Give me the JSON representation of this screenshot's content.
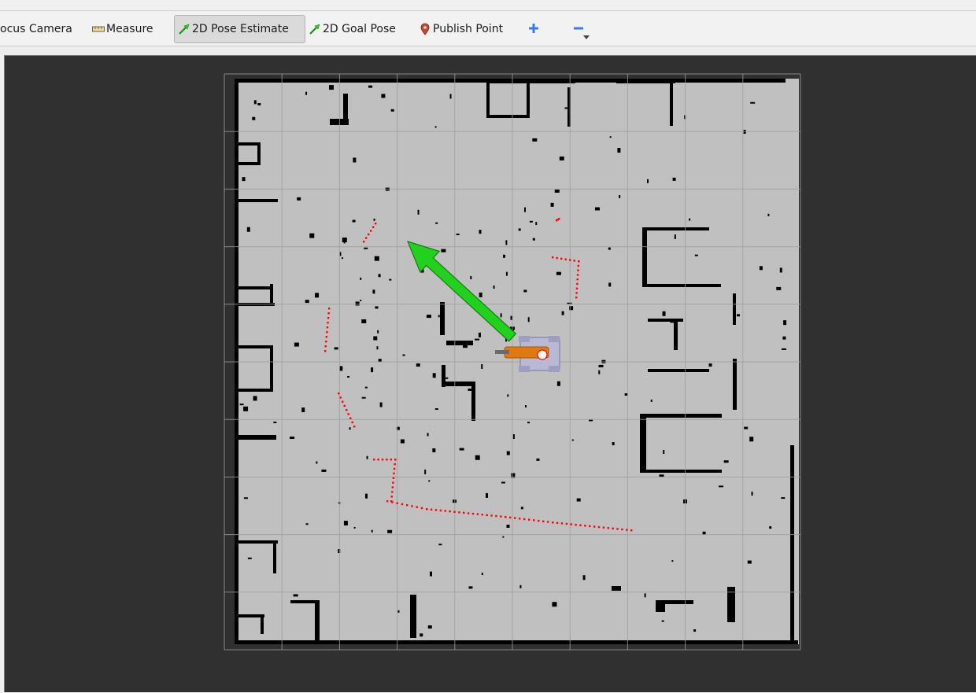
{
  "toolbar": {
    "tools": [
      {
        "id": "focus-camera",
        "label": "ocus Camera",
        "icon": "none"
      },
      {
        "id": "measure",
        "label": "Measure",
        "icon": "ruler-icon"
      },
      {
        "id": "pose-estimate",
        "label": "2D Pose Estimate",
        "icon": "green-arrow-icon",
        "active": true
      },
      {
        "id": "goal-pose",
        "label": "2D Goal Pose",
        "icon": "green-arrow-icon"
      },
      {
        "id": "publish-point",
        "label": "Publish Point",
        "icon": "map-pin-icon"
      }
    ],
    "add_icon": "plus-icon",
    "remove_icon": "minus-icon",
    "dropdown_icon": "caret-down-icon"
  },
  "colors": {
    "viewport_bg": "#303030",
    "map_free": "#c0c0c0",
    "map_occupied": "#000000",
    "grid_line": "#9e9e9e",
    "laser_scan": "#ff0000",
    "pose_arrow": "#22d11e",
    "robot_body": "#b9b9d6",
    "robot_arm": "#e07a10"
  },
  "viewport": {
    "map": "occupancy-grid",
    "grid_cells": 10,
    "pose_estimate_arrow": "visible",
    "robot": "visible"
  }
}
